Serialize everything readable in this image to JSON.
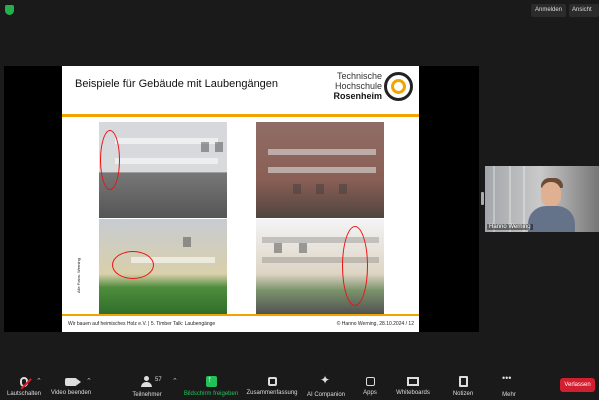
{
  "topbar": {
    "login": "Anmelden",
    "view": "Ansicht"
  },
  "slide": {
    "title": "Beispiele für Gebäude mit Laubengängen",
    "logo_line1": "Technische",
    "logo_line2": "Hochschule",
    "logo_line3": "Rosenheim",
    "photo_credit": "Alle Fotos: Werning",
    "footer_left": "Wir bauen auf heimisches Holz e.V. | 5. Timber Talk: Laubengänge",
    "footer_right": "© Hanno Werning, 28.10.2024 / 12"
  },
  "participant": {
    "name": "Hanno Werning"
  },
  "toolbar": {
    "mute": "Lautschalten",
    "video": "Video beenden",
    "participants": "Teilnehmer",
    "participant_count": "57",
    "share": "Bildschirm freigeben",
    "summary": "Zusammenfassung",
    "companion": "AI Companion",
    "apps": "Apps",
    "whiteboards": "Whiteboards",
    "notes": "Notizen",
    "more": "Mehr",
    "leave": "Verlassen"
  },
  "colors": {
    "accent_orange": "#f3a300",
    "share_green": "#23c15a",
    "leave_red": "#d21f2f"
  }
}
